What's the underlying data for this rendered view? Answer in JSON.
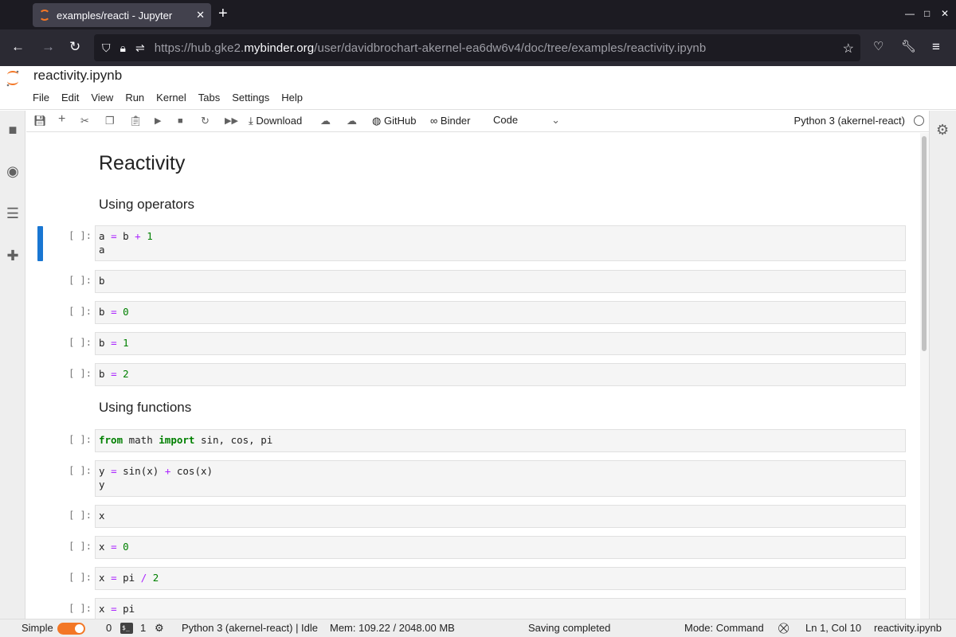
{
  "browser": {
    "tab_title": "examples/reacti - Jupyter",
    "url_prefix": "https://hub.gke2.",
    "url_domain": "mybinder.org",
    "url_path": "/user/davidbrochart-akernel-ea6dw6v4/doc/tree/examples/reactivity.ipynb"
  },
  "jupyter": {
    "notebook_name": "reactivity.ipynb",
    "menu": [
      "File",
      "Edit",
      "View",
      "Run",
      "Kernel",
      "Tabs",
      "Settings",
      "Help"
    ],
    "toolbar": {
      "download_label": "Download",
      "github_label": "GitHub",
      "binder_label": "Binder",
      "cell_type": "Code",
      "kernel_name": "Python 3 (akernel-react)"
    }
  },
  "notebook": {
    "h1": "Reactivity",
    "section1": "Using operators",
    "section2": "Using functions",
    "prompt": "[ ]:",
    "cells": [
      "a = b + 1\na",
      "b",
      "b = 0",
      "b = 1",
      "b = 2",
      "from math import sin, cos, pi",
      "y = sin(x) + cos(x)\ny",
      "x",
      "x = 0",
      "x = pi / 2",
      "x = pi"
    ]
  },
  "statusbar": {
    "mode_label": "Simple",
    "terminals_count": "0",
    "kernels_count": "1",
    "kernel_status": "Python 3 (akernel-react) | Idle",
    "memory": "Mem: 109.22 / 2048.00 MB",
    "save_status": "Saving completed",
    "mode": "Mode: Command",
    "cursor": "Ln 1, Col 10",
    "file": "reactivity.ipynb"
  },
  "colors": {
    "accent": "#f37726",
    "active_cell": "#1976d2",
    "operator": "#aa22ff",
    "number": "#008000"
  }
}
